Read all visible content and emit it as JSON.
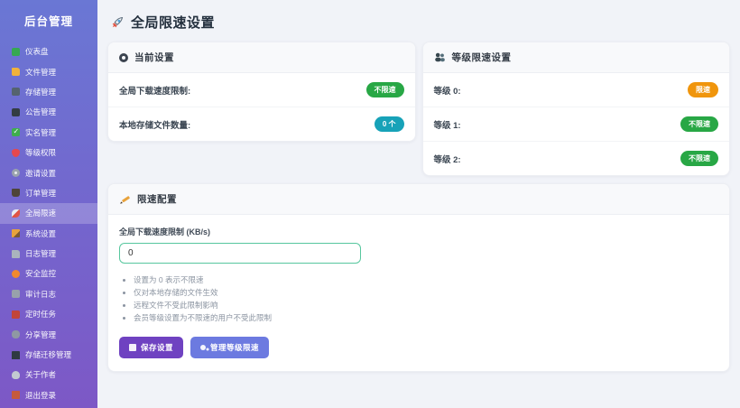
{
  "sidebar": {
    "title": "后台管理",
    "items": [
      {
        "label": "仪表盘",
        "icon": "dashboard",
        "active": false
      },
      {
        "label": "文件管理",
        "icon": "folder",
        "active": false
      },
      {
        "label": "存储管理",
        "icon": "storage",
        "active": false
      },
      {
        "label": "公告管理",
        "icon": "announcement",
        "active": false
      },
      {
        "label": "实名管理",
        "icon": "check",
        "active": false
      },
      {
        "label": "等级权限",
        "icon": "shield",
        "active": false
      },
      {
        "label": "邀请设置",
        "icon": "gear",
        "active": false
      },
      {
        "label": "订单管理",
        "icon": "cart",
        "active": false
      },
      {
        "label": "全局限速",
        "icon": "rocket",
        "active": true
      },
      {
        "label": "系统设置",
        "icon": "pencil",
        "active": false
      },
      {
        "label": "日志管理",
        "icon": "document",
        "active": false
      },
      {
        "label": "安全监控",
        "icon": "monitor",
        "active": false
      },
      {
        "label": "审计日志",
        "icon": "audit",
        "active": false
      },
      {
        "label": "定时任务",
        "icon": "book",
        "active": false
      },
      {
        "label": "分享管理",
        "icon": "paperclip",
        "active": false
      },
      {
        "label": "存储迁移管理",
        "icon": "laptop",
        "active": false
      },
      {
        "label": "关于作者",
        "icon": "person",
        "active": false
      },
      {
        "label": "退出登录",
        "icon": "logout-door",
        "active": false
      }
    ]
  },
  "header": {
    "title": "全局限速设置",
    "icon": "rocket"
  },
  "current_settings_card": {
    "title": "当前设置",
    "rows": [
      {
        "label": "全局下载速度限制:",
        "badge": "不限速",
        "badge_color": "#28a745"
      },
      {
        "label": "本地存储文件数量:",
        "badge": "0 个",
        "badge_color": "#17a2b8"
      }
    ]
  },
  "level_settings_card": {
    "title": "等级限速设置",
    "rows": [
      {
        "label": "等级 0:",
        "badge": "限速",
        "badge_color": "#f0950c"
      },
      {
        "label": "等级 1:",
        "badge": "不限速",
        "badge_color": "#28a745"
      },
      {
        "label": "等级 2:",
        "badge": "不限速",
        "badge_color": "#28a745"
      }
    ]
  },
  "config_card": {
    "title": "限速配置",
    "input_label": "全局下载速度限制 (KB/s)",
    "input_value": "0",
    "notes": [
      "设置为 0 表示不限速",
      "仅对本地存储的文件生效",
      "远程文件不受此限制影响",
      "会员等级设置为不限速的用户不受此限制"
    ],
    "save_button": "保存设置",
    "manage_button": "管理等级限速"
  },
  "colors": {
    "sidebar_gradient_top": "#6a77d4",
    "sidebar_gradient_bottom": "#7d58c6",
    "content_background": "#f1f3f8",
    "badge_green": "#28a745",
    "badge_teal": "#17a2b8",
    "badge_orange": "#f0950c",
    "save_button": "#6f42c1",
    "manage_button": "#6c7ae0",
    "input_border": "#57c79e"
  }
}
